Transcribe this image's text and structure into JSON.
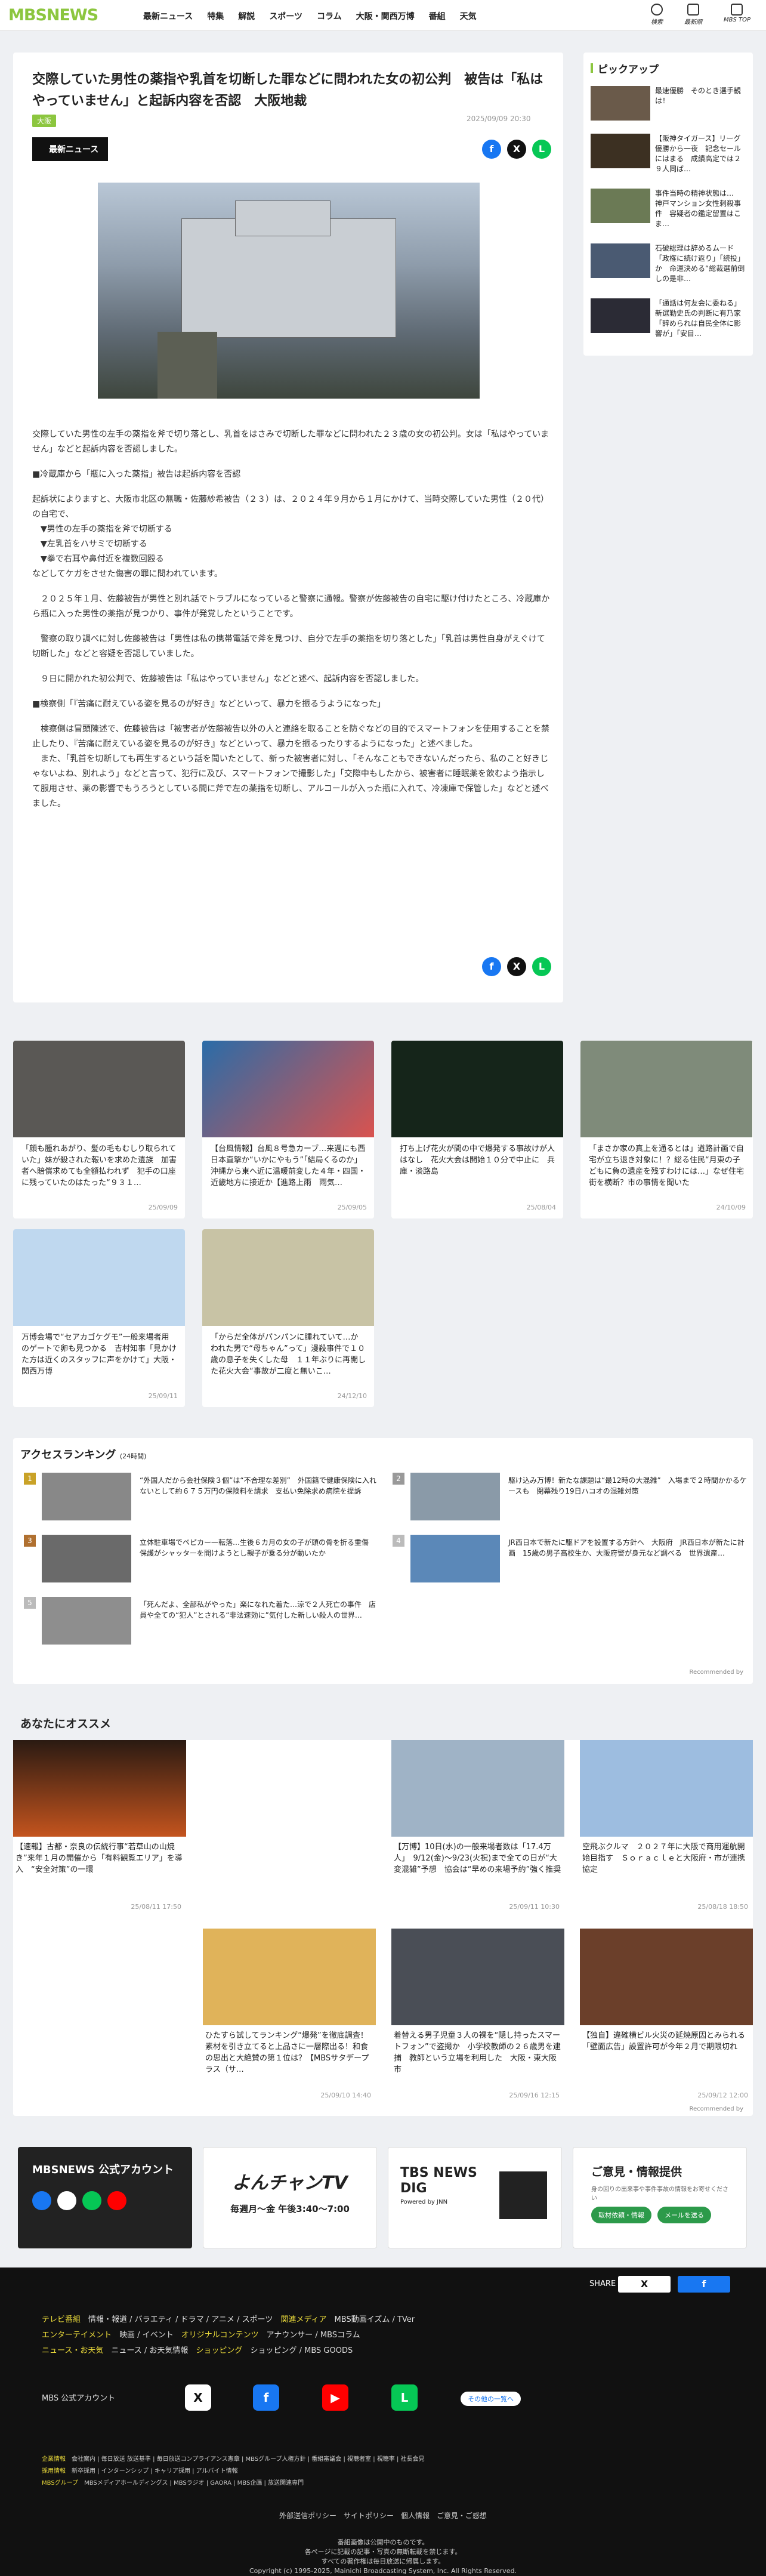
{
  "header": {
    "logo": "MBSNEWS",
    "nav": [
      "最新ニュース",
      "特集",
      "解説",
      "スポーツ",
      "コラム",
      "大阪・関西万博",
      "番組",
      "天気"
    ],
    "icons": [
      "検索",
      "最新順",
      "MBS TOP"
    ]
  },
  "article": {
    "title": "交際していた男性の薬指や乳首を切断した罪などに問われた女の初公判　被告は「私はやっていません」と起訴内容を否認　大阪地裁",
    "tag": "大阪",
    "date": "2025/09/09 20:30",
    "label": "最新ニュース",
    "paragraphs": [
      "交際していた男性の左手の薬指を斧で切り落とし、乳首をはさみで切断した罪などに問われた２３歳の女の初公判。女は「私はやっていません」などと起訴内容を否認しました。",
      "■冷蔵庫から「瓶に入った薬指」被告は起訴内容を否認",
      "起訴状によりますと、大阪市北区の無職・佐藤紗希被告（２３）は、２０２４年９月から１月にかけて、当時交際していた男性（２０代）の自宅で、\n　▼男性の左手の薬指を斧で切断する\n　▼左乳首をハサミで切断する\n　▼拳で右耳や鼻付近を複数回殴る\nなどしてケガをさせた傷害の罪に問われています。",
      "　２０２５年１月、佐藤被告が男性と別れ話でトラブルになっていると警察に通報。警察が佐藤被告の自宅に駆け付けたところ、冷蔵庫から瓶に入った男性の薬指が見つかり、事件が発覚したということです。",
      "　警察の取り調べに対し佐藤被告は「男性は私の携帯電話で斧を見つけ、自分で左手の薬指を切り落とした」「乳首は男性自身がえぐけて切断した」などと容疑を否認していました。",
      "　９日に開かれた初公判で、佐藤被告は「私はやっていません」などと述べ、起訴内容を否認しました。",
      "■検察側「『苦痛に耐えている姿を見るのが好き』などといって、暴力を振るうようになった」",
      "　検察側は冒頭陳述で、佐藤被告は「被害者が佐藤被告以外の人と連絡を取ることを防ぐなどの目的でスマートフォンを使用することを禁止したり、『苦痛に耐えている姿を見るのが好き』などといって、暴力を振るったりするようになった」と述べました。\n　また、「乳首を切断しても再生するという話を聞いたとして、新った被害者に対し、「そんなこともできないんだったら、私のこと好きじゃないよね、別れよう」などと言って、犯行に及び、スマートフォンで撮影した」「交際中もしたから、被害者に睡眠薬を飲むよう指示して服用させ、薬の影響でもうろうとしている間に斧で左の薬指を切断し、アルコールが入った瓶に入れて、冷凍庫で保管した」などと述べました。"
    ]
  },
  "pickup": {
    "heading": "ピックアップ",
    "items": [
      "最速優勝　そのとき選手観は！",
      "【阪神タイガース】リーグ優勝から一夜　記念セールにはまる　成績高定では２９人同ば…",
      "事件当時の精神状態は…　神戸マンション女性刺殺事件　容疑者の鑑定留置はこま…",
      "石破総理は辞めるムード「政権に続け返り」「続投」か　命運決める“総裁選前倒しの是非…",
      "「通話は何友会に委ねる」新選勤史氏の判断に有乃家「辞められは自民全体に影響が」「安目…"
    ]
  },
  "cards": [
    {
      "text": "「顔も腫れあがり、髪の毛もむしり取られていた」妹が殺された報いを求めた遺族　加害者へ賠償求めても全額払われず　犯手の口座に残っていたのはたった“９３１…",
      "date": "25/09/09"
    },
    {
      "text": "【台風情報】台風８号急カーブ…来週にも西日本直撃か“いかにやもう”「結局くるのか」沖縄から東へ近に温暖前変した４年・四国・近畿地方に接近か【進路上雨　雨気…",
      "date": "25/09/05"
    },
    {
      "text": "打ち上げ花火が間の中で爆発する事故けが人はなし　花火大会は開始１０分で中止に　兵庫・淡路島",
      "date": "25/08/04"
    },
    {
      "text": "「まさか家の真上を通るとは」道路計画で自宅が立ち退き対象に！？総る住民“月東の子どもに負の遺産を残すわけには…」なぜ住宅街を横断？市の事情を聞いた",
      "date": "24/10/09"
    },
    {
      "text": "万博会場で“セアカゴケグモ”一般来場者用のゲートで卵も見つかる　吉村知事「見かけた方は近くのスタッフに声をかけて」大阪・関西万博",
      "date": "25/09/11"
    },
    {
      "text": "「からだ全体がパンパンに腫れていて…かわれた男で“母ちゃん”って」漫殺事件で１０歳の息子を失くした母　１１年ぶりに再開した花火大会“事故が二度と無いこ…",
      "date": "24/12/10"
    }
  ],
  "ranking": {
    "heading": "アクセスランキング",
    "sub": "(24時間)",
    "items": [
      "“外国人だから会社保険３個”は“不合理な差別”　外国籍で健康保険に入れないとして約６７５万円の保険料を請求　支払い免除求め病院を提訴",
      "駆け込み万博！新たな課題は“最12時の大混雑”　入場まで２時間かかるケースも　閉幕残り19日ハコオの混雑対策",
      "立体駐車場でペピカー一転落…生後６カ月の女の子が頭の骨を折る重傷　保護がシャッターを開けようとし親子が乗る分が動いたか",
      "JR西日本で新たに駆ドアを設置する方針へ　大阪府　JR西日本が新たに計画　15歳の男子高校生か、大阪府警が身元など調べる　世界遺産…",
      "「死んだよ、全部私がやった」楽になれた着た…涼で２人死亡の事件　店員や全ての“犯人”とされる“非法速効に”気付した新しい殺人の世界…"
    ],
    "rec": "Recommended by"
  },
  "osusume": {
    "heading": "あなたにオススメ",
    "items": [
      {
        "text": "【速報】古都・奈良の伝統行事“若草山の山焼き”来年１月の開催から「有料観覧エリア」を導入　“安全対策”の一環",
        "date": "25/08/11 17:50"
      },
      {
        "text": "【万博】10日(水)の一般来場者数は「17.4万人」　9/12(金)〜9/23(火祝)まで全ての日が“大変混雑”予想　協会は“早めの来場予約”強く推奨",
        "date": "25/09/11 10:30"
      },
      {
        "text": "空飛ぶクルマ　２０２７年に大阪で商用運航開始目指す　Ｓｏｒａｃｌｅと大阪府・市が連携協定",
        "date": "25/08/18 18:50"
      },
      {
        "text": "",
        "date": ""
      },
      {
        "text": "ひたすら試してランキング“爆発”を徹底調査！　素材を引き立てると上品さに一層際出る！和食の思出と大絶賛の第１位は？【MBSサタデープラス（サ…",
        "date": "25/09/10 14:40"
      },
      {
        "text": "着替える男子児童３人の裸を“隠し持ったスマートフォン”で盗撮か　小学校教師の２６歳男を逮捕　教師という立場を利用した　大阪・東大阪市",
        "date": "25/09/16 12:15"
      },
      {
        "text": "【独自】違確横ビル火災の延焼原因とみられる「壁面広告」設置許可が今年２月で期限切れ",
        "date": "25/09/12 12:00"
      }
    ],
    "rec": "Recommended by"
  },
  "banners": {
    "official": "MBSNEWS 公式アカウント",
    "yonchan": "よんチャンTV",
    "yonchan_time": "毎週月〜金 午後3:40〜7:00",
    "tbs": "TBS NEWS DIG",
    "tbs_sub": "Powered by JNN",
    "iken": "ご意見・情報提供",
    "iken_sub": "身の回りの出来事や事件事故の情報をお寄せください",
    "b1": "取材依頼・情報",
    "b2": "メールを送る"
  },
  "footer": {
    "share": "SHARE",
    "rows": [
      [
        "テレビ番組",
        "情報・報道",
        "バラエティ",
        "ドラマ",
        "アニメ",
        "スポーツ",
        "関連メディア",
        "MBS動画イズム",
        "TVer"
      ],
      [
        "エンターテイメント",
        "映画",
        "イベント",
        "オリジナルコンテンツ",
        "アナウンサー",
        "MBSコラム"
      ],
      [
        "ニュース・お天気",
        "ニュース",
        "お天気情報",
        "ショッピング",
        "ショッピング",
        "MBS GOODS"
      ]
    ],
    "sns_label": "MBS 公式アカウント",
    "more": "その他の一覧へ",
    "links": [
      "企業情報",
      "会社案内",
      "毎日放送 放送基準",
      "毎日放送コンプライアンス憲章",
      "MBSグループ人権方針",
      "番組審議会",
      "視聴者室",
      "視聴率",
      "社長会見",
      "採用情報",
      "新卒採用",
      "インターンシップ",
      "キャリア採用",
      "アルバイト情報",
      "MBSグループ",
      "MBSメディアホールディングス",
      "MBSラジオ",
      "GAORA",
      "MBS企画",
      "放送関連専門"
    ],
    "policy": [
      "外部送信ポリシー",
      "サイトポリシー",
      "個人情報",
      "ご意見・ご感想"
    ],
    "copy": [
      "番組画像は公開中のものです。",
      "各ページに記載の記事・写真の無断転載を禁じます。",
      "すべての著作権は毎日放送に帰属します。",
      "Copyright (c) 1995-2025, Mainichi Broadcasting System, Inc. All Rights Reserved."
    ]
  }
}
